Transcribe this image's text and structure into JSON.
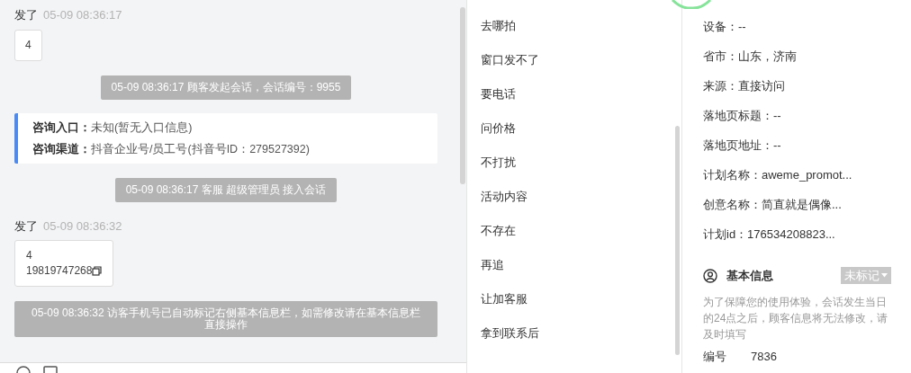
{
  "chat": {
    "messages": [
      {
        "kind": "message",
        "sender": "发了",
        "time": "05-09 08:36:17",
        "lines": [
          "4"
        ],
        "copyable": false
      },
      {
        "kind": "system",
        "text": "05-09 08:36:17 顾客发起会话，会话编号：9955"
      },
      {
        "kind": "card",
        "rows": [
          {
            "label": "咨询入口：",
            "value": "未知(暂无入口信息)"
          },
          {
            "label": "咨询渠道：",
            "value": "抖音企业号/员工号(抖音号ID：279527392)"
          }
        ]
      },
      {
        "kind": "system",
        "text": "05-09 08:36:17 客服 超级管理员 接入会话"
      },
      {
        "kind": "message",
        "sender": "发了",
        "time": "05-09 08:36:32",
        "lines": [
          "4",
          "19819747268"
        ],
        "copyable": true
      },
      {
        "kind": "system",
        "text": "05-09 08:36:32 访客手机号已自动标记右侧基本信息栏，如需修改请在基本信息栏直接操作"
      }
    ]
  },
  "quick_replies": [
    "去哪拍",
    "窗口发不了",
    "要电话",
    "问价格",
    "不打扰",
    "活动内容",
    "不存在",
    "再追",
    "让加客服",
    "拿到联系后"
  ],
  "visitor_info": [
    "设备：--",
    "省市：山东，济南",
    "来源：直接访问",
    "落地页标题：--",
    "落地页地址：--",
    "计划名称：aweme_promot...",
    "创意名称：简直就是偶像...",
    "计划id：176534208823..."
  ],
  "basic_info": {
    "title": "基本信息",
    "tag": "未标记",
    "notice": "为了保障您的使用体验，会话发生当日的24点之后，顾客信息将无法修改，请及时填写",
    "fields": [
      {
        "label": "编号",
        "value": "7836"
      }
    ]
  }
}
